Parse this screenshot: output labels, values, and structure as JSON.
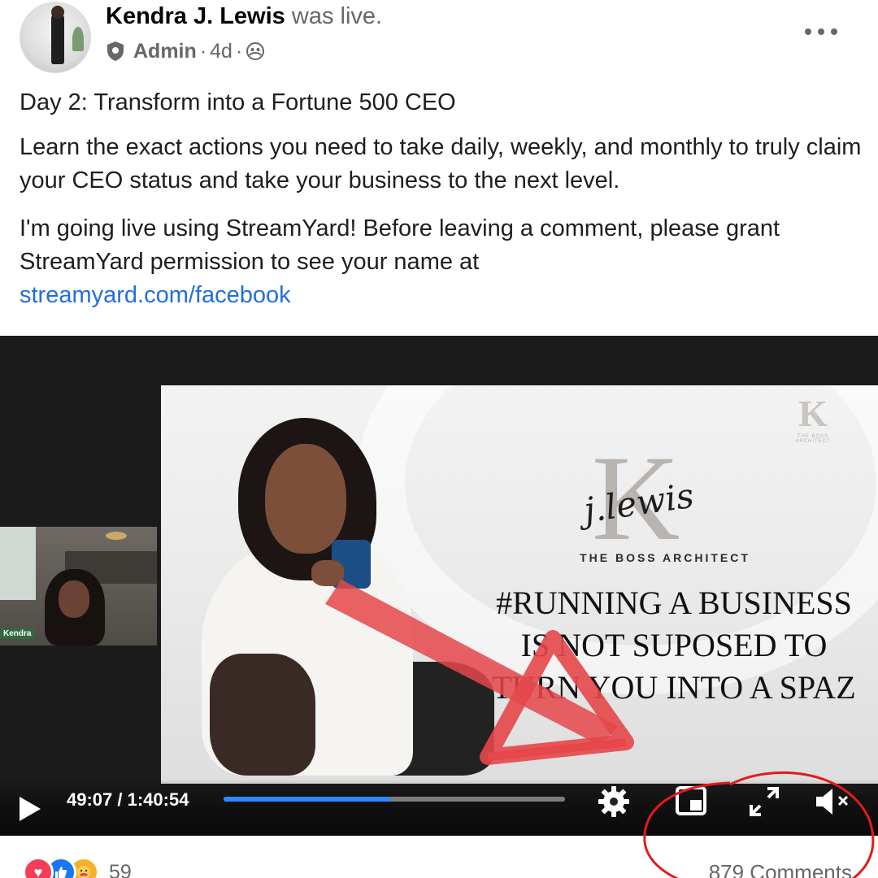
{
  "post": {
    "author": "Kendra J. Lewis",
    "action": "was live.",
    "role": "Admin",
    "time": "4d",
    "more_label": "•••"
  },
  "body": {
    "title_line": "Day 2: Transform into a Fortune 500 CEO",
    "paragraph": "Learn the exact actions you need to take daily, weekly, and monthly to truly claim your CEO status and take your business to the next level.",
    "streamyard_text": "I'm going live using StreamYard! Before leaving a comment, please grant StreamYard permission to see your name at",
    "link": "streamyard.com/facebook"
  },
  "video": {
    "slide_corner_logo": "K",
    "slide_corner_tagline": "THE BOSS ARCHITECT",
    "brand_letter": "K",
    "brand_signature": "j.lewis",
    "slide_tagline": "THE BOSS ARCHITECT",
    "slide_headline": "#RUNNING A BUSINESS IS NOT SUPOSED TO TURN YOU INTO A SPAZ",
    "webcam_label": "Kendra",
    "time_display": "49:07 / 1:40:54",
    "progress_fraction": 0.49,
    "icons": [
      "play-icon",
      "settings-gear-icon",
      "picture-in-picture-icon",
      "fullscreen-icon",
      "muted-volume-icon"
    ]
  },
  "footer": {
    "reaction_count": "59",
    "comments": "879 Comments",
    "reaction_icons": [
      "love-reaction-icon",
      "like-reaction-icon",
      "care-reaction-icon"
    ]
  },
  "annotations": {
    "color": "#e21b1b",
    "arrow_color": "#e5474a"
  }
}
